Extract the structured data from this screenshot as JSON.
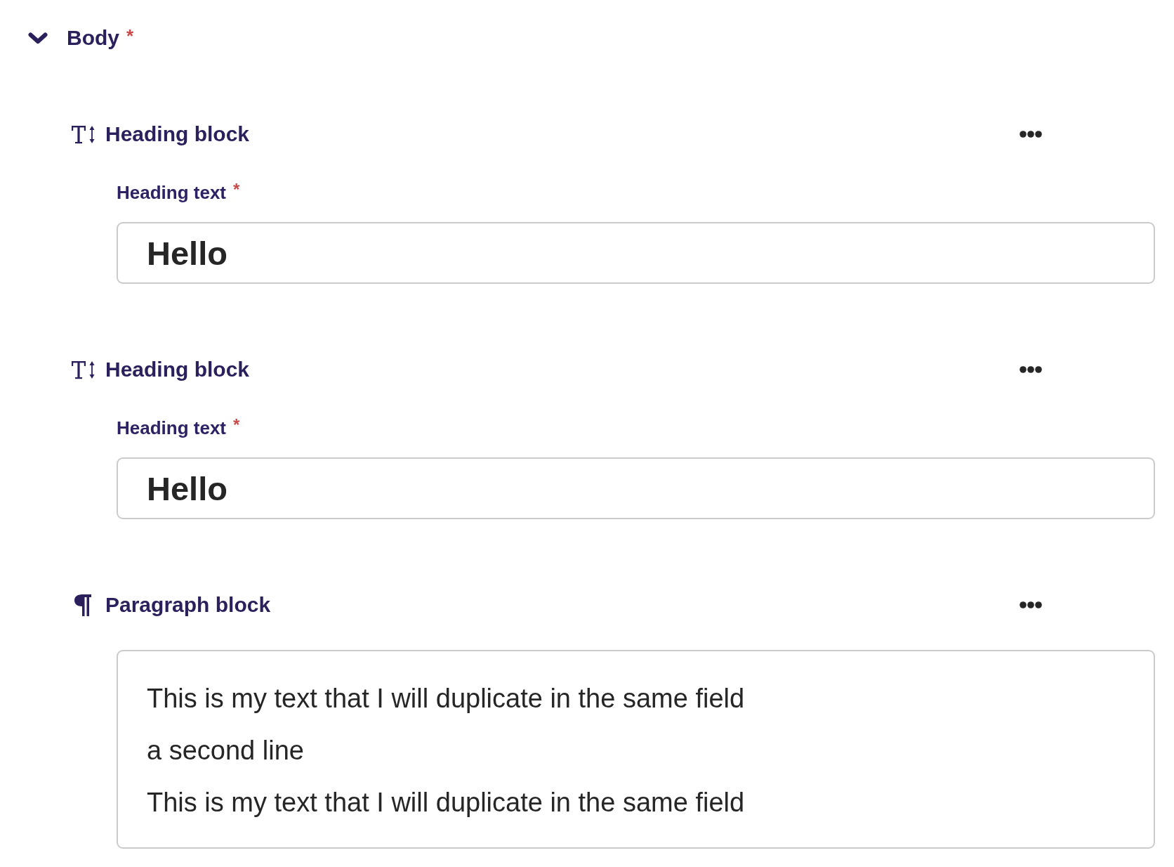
{
  "section": {
    "title": "Body",
    "required_mark": "*",
    "expanded": true
  },
  "blocks": [
    {
      "kind": "heading",
      "title": "Heading block",
      "field": {
        "label": "Heading text",
        "required_mark": "*",
        "value": "Hello"
      }
    },
    {
      "kind": "heading",
      "title": "Heading block",
      "field": {
        "label": "Heading text",
        "required_mark": "*",
        "value": "Hello"
      }
    },
    {
      "kind": "paragraph",
      "title": "Paragraph block",
      "field": {
        "lines": [
          "This is my text that I will duplicate in the same field",
          "a second line",
          "This is my text that I will duplicate in the same field"
        ]
      }
    }
  ]
}
